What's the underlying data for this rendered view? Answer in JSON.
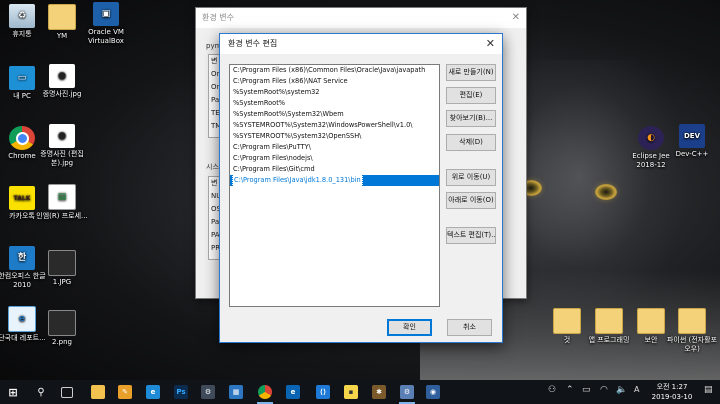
{
  "desktop": {
    "icons_left": [
      {
        "label": "휴지통",
        "icon": "recycle-bin-icon"
      },
      {
        "label": "YM",
        "icon": "folder-icon"
      },
      {
        "label": "Oracle VM VirtualBox",
        "icon": "virtualbox-icon"
      },
      {
        "label": "내 PC",
        "icon": "computer-icon"
      },
      {
        "label": "증명사진.jpg",
        "icon": "photo-icon"
      },
      {
        "label": "Chrome",
        "icon": "chrome-icon"
      },
      {
        "label": "증명사진 (편집본).jpg",
        "icon": "photo-icon"
      },
      {
        "label": "카카오톡",
        "icon": "kakaotalk-icon"
      },
      {
        "label": "인엠(R) 프로세...",
        "icon": "document-icon"
      },
      {
        "label": "한컴오피스 한글 2010",
        "icon": "hwp-icon"
      },
      {
        "label": "1.JPG",
        "icon": "image-file-icon"
      },
      {
        "label": "단국대 레포트...",
        "icon": "document-icon"
      },
      {
        "label": "2.png",
        "icon": "image-file-icon"
      }
    ],
    "icons_right": [
      {
        "label": "Eclipse Jee 2018-12",
        "icon": "eclipse-icon"
      },
      {
        "label": "Dev-C++",
        "icon": "devcpp-icon"
      },
      {
        "label": "것",
        "icon": "folder-icon"
      },
      {
        "label": "앱 프로그래밍",
        "icon": "folder-icon"
      },
      {
        "label": "보안",
        "icon": "folder-icon"
      },
      {
        "label": "파이썬 (전자활포오우)",
        "icon": "folder-icon"
      }
    ]
  },
  "bg_window": {
    "title": "환경 변수",
    "user_group_label": "pym",
    "user_list": [
      "변",
      "On",
      "On",
      "Pa",
      "TE",
      "TM"
    ],
    "system_group_label": "시스",
    "system_list": [
      "변",
      "NU",
      "OS",
      "Pa",
      "PA",
      "PR"
    ]
  },
  "dialog": {
    "title": "환경 변수 편집",
    "paths": [
      "C:\\Program Files (x86)\\Common Files\\Oracle\\Java\\javapath",
      "C:\\Program Files (x86)\\NAT Service",
      "%SystemRoot%\\system32",
      "%SystemRoot%",
      "%SystemRoot%\\System32\\Wbem",
      "%SYSTEMROOT%\\System32\\WindowsPowerShell\\v1.0\\",
      "%SYSTEMROOT%\\System32\\OpenSSH\\",
      "C:\\Program Files\\PuTTY\\",
      "C:\\Program Files\\nodejs\\",
      "C:\\Program Files\\Git\\cmd",
      "C:\\Program Files\\Java\\jdk1.8.0_131\\bin"
    ],
    "selected_prefix": "C:\\Program Files\\Java\\jdk1.8.0_131\\bin",
    "buttons": {
      "new": "새로 만들기(N)",
      "edit": "편집(E)",
      "browse": "찾아보기(B)...",
      "delete": "삭제(D)",
      "up": "위로 이동(U)",
      "down": "아래로 이동(O)",
      "edit_text": "텍스트 편집(T)..."
    },
    "ok": "확인",
    "cancel": "취소"
  },
  "taskbar": {
    "time": "오전 1:27",
    "date": "2019-03-10",
    "apps": [
      "start-icon",
      "search-icon",
      "task-view-icon",
      "file-explorer-icon",
      "paint-icon",
      "edge-icon",
      "photoshop-icon",
      "settings-icon",
      "photos-icon",
      "chrome-icon",
      "edge-icon",
      "vscode-icon",
      "sticky-notes-icon",
      "app-icon",
      "settings-gear-icon",
      "network-icon",
      "eclipse-icon"
    ]
  }
}
